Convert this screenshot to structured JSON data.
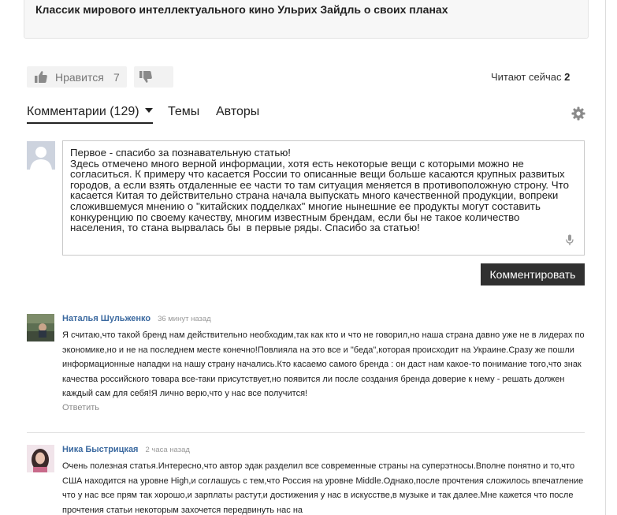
{
  "article": {
    "title": "Классик мирового интеллектуального кино Ульрих Зайдль о своих планах"
  },
  "reactions": {
    "like_label": "Нравится",
    "like_count": "7",
    "reading_now_label": "Читают сейчас",
    "reading_now_count": "2"
  },
  "tabs": {
    "comments": "Комментарии (129)",
    "topics": "Темы",
    "authors": "Авторы"
  },
  "composer": {
    "text": "Первое - спасибо за познавательную статью!\nЗдесь отмечено много верной информации, хотя есть некоторые вещи с которыми можно не согласиться. К примеру что касается России то описанные вещи больше касаются крупных развитых городов, а если взять отдаленные ее части то там ситуация меняется в противоположную строну. Что касается Китая то действительно страна начала выпускать много качественной продукции, вопреки сложившемуся мнению о \"китайских подделках\" многие нынешние ее продукты могут составить конкуренцию по своему качеству, многим известным брендам, если бы не такое количество населения, то стана вырвалась бы  в первые ряды. Спасибо за статью!",
    "submit_label": "Комментировать"
  },
  "comments": [
    {
      "author": "Наталья Шульженко",
      "time": "36 минут назад",
      "text": "Я считаю,что такой бренд нам действительно необходим,так как кто и что не говорил,но наша страна давно уже не в лидерах по экономике,но и не на последнем месте конечно!Повлияла на это все и \"беда\",которая происходит на Украине.Сразу же пошли информационные нападки на нашу страну начались.Кто касаемо самого бренда : он даст нам какое-то понимание того,что знак качества российского товара все-таки присутствует,но появится ли после создания бренда доверие к нему - решать должен каждый сам для себя!Я лично верю,что у нас все получится!",
      "reply_label": "Ответить"
    },
    {
      "author": "Ника Быстрицкая",
      "time": "2 часа назад",
      "text": "Очень полезная статья.Интересно,что автор эдак разделил все современные страны на суперэтносы.Вполне понятно и то,что США находится на уровне High,и соглашусь с тем,что Россия на уровне Middle.Однако,после прочтения сложилось впечатление что у нас все прям так хорошо,и зарплаты растут,и достижения у нас в искусстве,в музыке и так далее.Мне кажется что после прочтения статьи некоторым захочется передвинуть нас на"
    }
  ],
  "colors": {
    "author_link": "#3c6aa0",
    "submit_bg": "#303030",
    "avatar_placeholder": "#cdd3de"
  }
}
